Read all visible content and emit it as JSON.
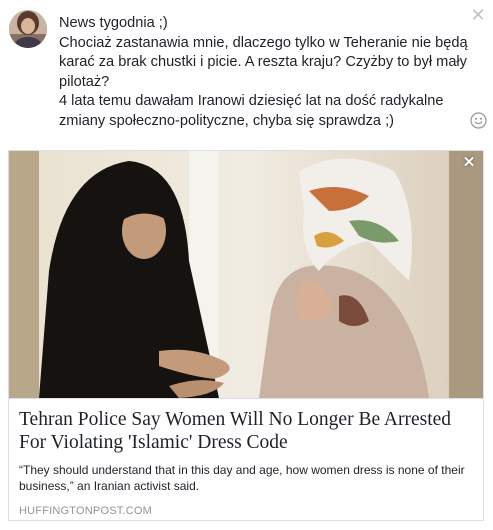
{
  "post": {
    "text": "News tygodnia ;)\nChociaż zastanawia mnie, dlaczego tylko w Teheranie nie będą karać za brak chustki i picie. A reszta kraju? Czyżby to był mały pilotaż?\n4 lata temu dawałam Iranowi dziesięć lat na dość radykalne zmiany społeczno-polityczne, chyba się sprawdza ;)"
  },
  "icons": {
    "close": "close-icon",
    "emoji": "smiley-icon",
    "remove_preview": "remove-preview-icon"
  },
  "link_preview": {
    "title": "Tehran Police Say Women Will No Longer Be Arrested For Violating 'Islamic' Dress Code",
    "description": "“They should understand that in this day and age, how women dress is none of their business,” an Iranian activist said.",
    "domain": "HUFFINGTONPOST.COM"
  },
  "colors": {
    "text": "#1d2129",
    "secondary": "#90949c",
    "border": "#dddfe2"
  }
}
